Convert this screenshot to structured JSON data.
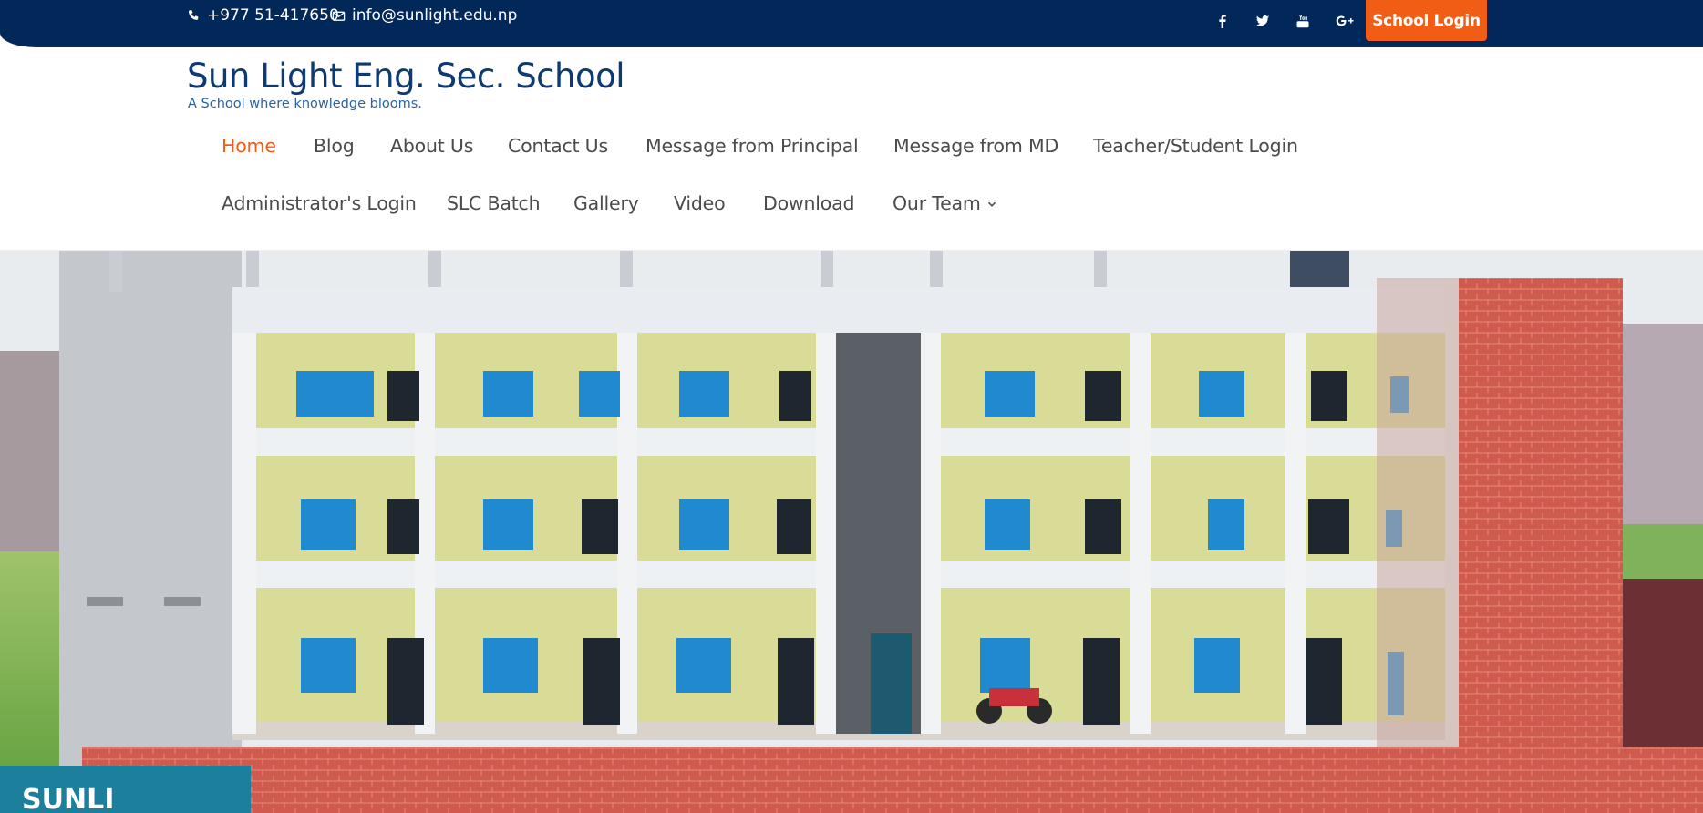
{
  "topbar": {
    "phone": "+977 51-417650",
    "email": "info@sunlight.edu.np",
    "social_icons": [
      "facebook-icon",
      "twitter-icon",
      "youtube-icon",
      "google-plus-icon"
    ],
    "login_label": "School Login",
    "bg_color": "#022859",
    "accent_color": "#f25d16"
  },
  "header": {
    "title": "Sun Light Eng. Sec. School",
    "tagline": "A School where knowledge blooms."
  },
  "nav": {
    "items": [
      {
        "label": "Home",
        "active": true
      },
      {
        "label": "Blog"
      },
      {
        "label": "About Us"
      },
      {
        "label": "Contact Us"
      },
      {
        "label": "Message from Principal"
      },
      {
        "label": "Message from MD"
      },
      {
        "label": "Teacher/Student Login"
      },
      {
        "label": "Administrator's Login"
      },
      {
        "label": "SLC Batch"
      },
      {
        "label": "Gallery"
      },
      {
        "label": "Video"
      },
      {
        "label": "Download"
      },
      {
        "label": "Our Team",
        "has_dropdown": true
      }
    ]
  },
  "hero": {
    "image": "school-building-photo",
    "sign_text": "SUNLI"
  }
}
